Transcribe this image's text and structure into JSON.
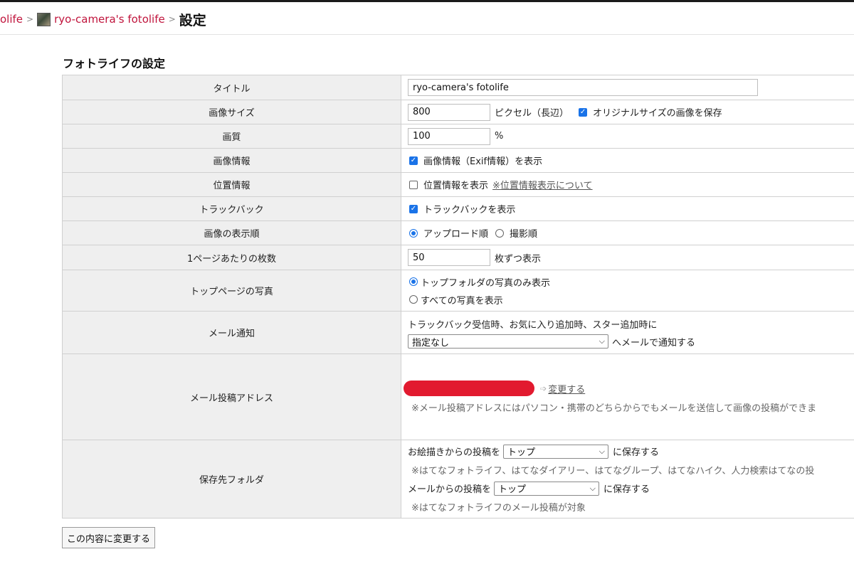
{
  "breadcrumb": {
    "items": [
      "olife",
      "ryo-camera's fotolife"
    ],
    "separator": ">",
    "current": "設定"
  },
  "section_title": "フォトライフの設定",
  "rows": {
    "title": {
      "label": "タイトル",
      "value": "ryo-camera's fotolife"
    },
    "image_size": {
      "label": "画像サイズ",
      "value": "800",
      "unit": "ピクセル（長辺）",
      "checkbox_label": "オリジナルサイズの画像を保存",
      "checkbox_checked": true
    },
    "quality": {
      "label": "画質",
      "value": "100",
      "unit": "%"
    },
    "image_info": {
      "label": "画像情報",
      "checkbox_label": "画像情報（Exif情報）を表示",
      "checkbox_checked": true
    },
    "location": {
      "label": "位置情報",
      "checkbox_label": "位置情報を表示",
      "checkbox_checked": false,
      "link": "※位置情報表示について"
    },
    "trackback": {
      "label": "トラックバック",
      "checkbox_label": "トラックバックを表示",
      "checkbox_checked": true
    },
    "display_order": {
      "label": "画像の表示順",
      "option1": "アップロード順",
      "option2": "撮影順",
      "selected": "アップロード順"
    },
    "per_page": {
      "label": "1ページあたりの枚数",
      "value": "50",
      "unit": "枚ずつ表示"
    },
    "top_photos": {
      "label": "トップページの写真",
      "option1": "トップフォルダの写真のみ表示",
      "option2": "すべての写真を表示",
      "selected": "トップフォルダの写真のみ表示"
    },
    "mail_notify": {
      "label": "メール通知",
      "description": "トラックバック受信時、お気に入り追加時、スター追加時に",
      "select_value": "指定なし",
      "suffix": "へメールで通知する"
    },
    "mail_address": {
      "label": "メール投稿アドレス",
      "change_link": "変更する",
      "note": "※メール投稿アドレスにはパソコン・携帯のどちらからでもメールを送信して画像の投稿ができま"
    },
    "save_folder": {
      "label": "保存先フォルダ",
      "drawing_prefix": "お絵描きからの投稿を",
      "drawing_select": "トップ",
      "drawing_suffix": "に保存する",
      "drawing_note": "※はてなフォトライフ、はてなダイアリー、はてなグループ、はてなハイク、人力検索はてなの投",
      "mail_prefix": "メールからの投稿を",
      "mail_select": "トップ",
      "mail_suffix": "に保存する",
      "mail_note": "※はてなフォトライフのメール投稿が対象"
    }
  },
  "submit_label": "この内容に変更する",
  "colors": {
    "link": "#c0143c",
    "accent": "#1a73e8",
    "redaction": "#e21a2f"
  }
}
